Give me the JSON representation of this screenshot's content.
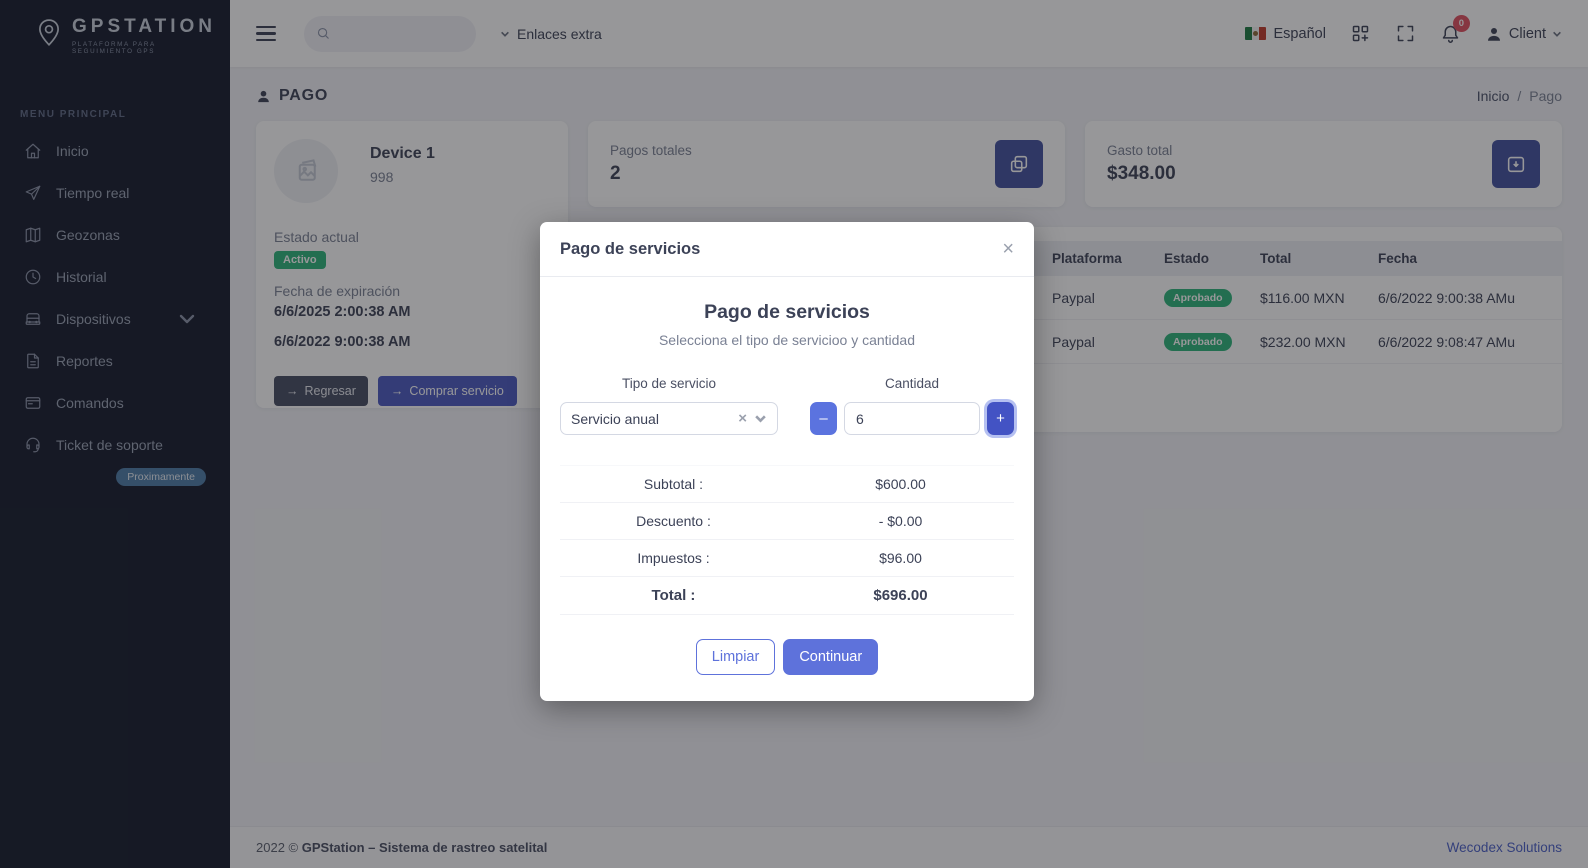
{
  "sidebar": {
    "logo_title": "GPSTATION",
    "logo_tagline": "PLATAFORMA PARA SEGUIMIENTO GPS",
    "menu_label": "MENU PRINCIPAL",
    "items": [
      {
        "label": "Inicio"
      },
      {
        "label": "Tiempo real"
      },
      {
        "label": "Geozonas"
      },
      {
        "label": "Historial"
      },
      {
        "label": "Dispositivos"
      },
      {
        "label": "Reportes"
      },
      {
        "label": "Comandos"
      },
      {
        "label": "Ticket de soporte"
      }
    ],
    "coming_soon_badge": "Proximamente"
  },
  "topbar": {
    "links_dropdown": "Enlaces extra",
    "language": "Español",
    "notification_count": "0",
    "user": "Client"
  },
  "page": {
    "title": "PAGO",
    "breadcrumb_home": "Inicio",
    "breadcrumb_sep": "/",
    "breadcrumb_current": "Pago"
  },
  "device_card": {
    "name": "Device 1",
    "imei": "998",
    "status_label": "Estado actual",
    "status_value": "Activo",
    "expiration_label": "Fecha de expiración",
    "expiration_date": "6/6/2025 2:00:38 AM",
    "purchase_date": "6/6/2022 9:00:38 AM",
    "back_button": "Regresar",
    "buy_button": "Comprar servicio",
    "arrow_glyph": "→"
  },
  "stats": {
    "payments": {
      "label": "Pagos totales",
      "value": "2"
    },
    "spending": {
      "label": "Gasto total",
      "value": "$348.00"
    }
  },
  "payments_table": {
    "headers": {
      "platform": "Plataforma",
      "status": "Estado",
      "total": "Total",
      "date": "Fecha"
    },
    "rows": [
      {
        "platform": "Paypal",
        "status": "Aprobado",
        "total": "$116.00 MXN",
        "date": "6/6/2022 9:00:38 AMu"
      },
      {
        "platform": "Paypal",
        "status": "Aprobado",
        "total": "$232.00 MXN",
        "date": "6/6/2022 9:08:47 AMu"
      }
    ]
  },
  "modal": {
    "title": "Pago de servicios",
    "close_glyph": "×",
    "heading": "Pago de servicios",
    "subtitle": "Selecciona el tipo de servicioo y cantidad",
    "service_label": "Tipo de servicio",
    "service_value": "Servicio anual",
    "clear_glyph": "×",
    "quantity_label": "Cantidad",
    "quantity_value": "6",
    "minus_glyph": "–",
    "plus_glyph": "+",
    "totals": [
      {
        "label": "Subtotal :",
        "value": "$600.00"
      },
      {
        "label": "Descuento :",
        "value": "- $0.00"
      },
      {
        "label": "Impuestos :",
        "value": "$96.00"
      },
      {
        "label": "Total :",
        "value": "$696.00"
      }
    ],
    "clear_button": "Limpiar",
    "continue_button": "Continuar"
  },
  "footer": {
    "copyright_prefix": "2022 © ",
    "copyright_bold": "GPStation – Sistema de rastreo satelital",
    "credit": "Wecodex Solutions"
  },
  "colors": {
    "sidebar_bg": "#141a2c",
    "accent_indigo": "#5e72db",
    "success_green": "#2db57a",
    "notification_red": "#e04f5f",
    "credit_blue": "#4c61c9"
  }
}
